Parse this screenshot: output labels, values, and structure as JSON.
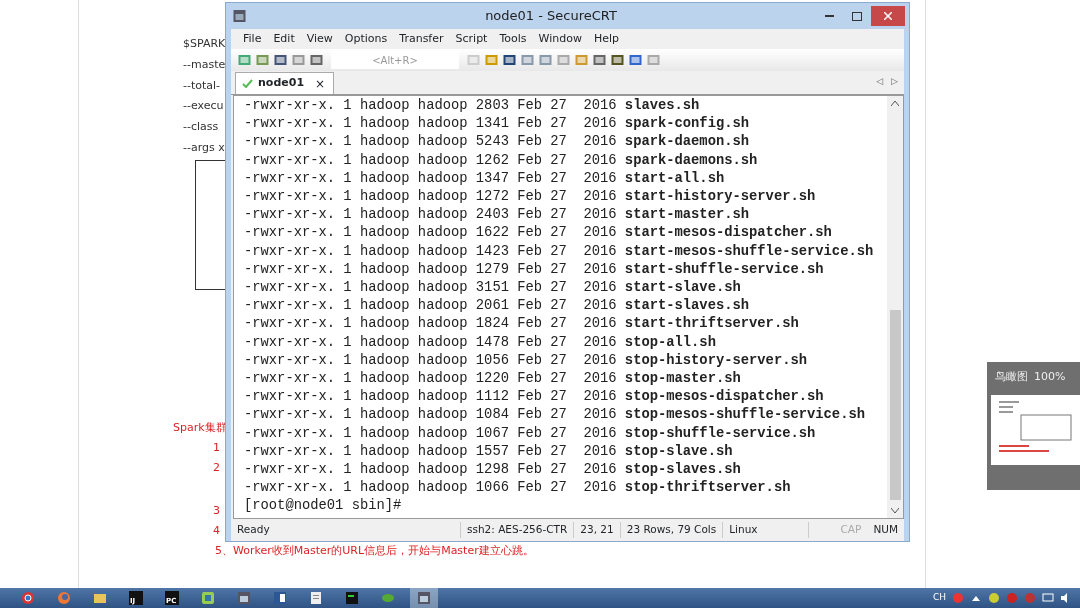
{
  "document": {
    "lines": [
      "$SPARK",
      "--maste",
      "--total-",
      "--execu",
      "--class",
      "--args x"
    ],
    "notes": [
      "Spark集群",
      "1",
      "2",
      "3",
      "4",
      "5、Worker收到Master的URL信息后，开始与Master建立心跳。"
    ]
  },
  "window": {
    "title": "node01 - SecureCRT",
    "menu": [
      "File",
      "Edit",
      "View",
      "Options",
      "Transfer",
      "Script",
      "Tools",
      "Window",
      "Help"
    ],
    "toolbar": {
      "placeholder": "<Alt+R>"
    },
    "tabs": [
      {
        "label": "node01",
        "close": "×",
        "selected": true,
        "connected": true
      }
    ],
    "tab_scroll": [
      "◁",
      "▷"
    ],
    "terminal": {
      "lines": [
        {
          "meta": "-rwxr-xr-x. 1 hadoop hadoop 2803 Feb 27  2016",
          "file": "slaves.sh"
        },
        {
          "meta": "-rwxr-xr-x. 1 hadoop hadoop 1341 Feb 27  2016",
          "file": "spark-config.sh"
        },
        {
          "meta": "-rwxr-xr-x. 1 hadoop hadoop 5243 Feb 27  2016",
          "file": "spark-daemon.sh"
        },
        {
          "meta": "-rwxr-xr-x. 1 hadoop hadoop 1262 Feb 27  2016",
          "file": "spark-daemons.sh"
        },
        {
          "meta": "-rwxr-xr-x. 1 hadoop hadoop 1347 Feb 27  2016",
          "file": "start-all.sh"
        },
        {
          "meta": "-rwxr-xr-x. 1 hadoop hadoop 1272 Feb 27  2016",
          "file": "start-history-server.sh"
        },
        {
          "meta": "-rwxr-xr-x. 1 hadoop hadoop 2403 Feb 27  2016",
          "file": "start-master.sh"
        },
        {
          "meta": "-rwxr-xr-x. 1 hadoop hadoop 1622 Feb 27  2016",
          "file": "start-mesos-dispatcher.sh"
        },
        {
          "meta": "-rwxr-xr-x. 1 hadoop hadoop 1423 Feb 27  2016",
          "file": "start-mesos-shuffle-service.sh"
        },
        {
          "meta": "-rwxr-xr-x. 1 hadoop hadoop 1279 Feb 27  2016",
          "file": "start-shuffle-service.sh"
        },
        {
          "meta": "-rwxr-xr-x. 1 hadoop hadoop 3151 Feb 27  2016",
          "file": "start-slave.sh"
        },
        {
          "meta": "-rwxr-xr-x. 1 hadoop hadoop 2061 Feb 27  2016",
          "file": "start-slaves.sh"
        },
        {
          "meta": "-rwxr-xr-x. 1 hadoop hadoop 1824 Feb 27  2016",
          "file": "start-thriftserver.sh"
        },
        {
          "meta": "-rwxr-xr-x. 1 hadoop hadoop 1478 Feb 27  2016",
          "file": "stop-all.sh"
        },
        {
          "meta": "-rwxr-xr-x. 1 hadoop hadoop 1056 Feb 27  2016",
          "file": "stop-history-server.sh"
        },
        {
          "meta": "-rwxr-xr-x. 1 hadoop hadoop 1220 Feb 27  2016",
          "file": "stop-master.sh"
        },
        {
          "meta": "-rwxr-xr-x. 1 hadoop hadoop 1112 Feb 27  2016",
          "file": "stop-mesos-dispatcher.sh"
        },
        {
          "meta": "-rwxr-xr-x. 1 hadoop hadoop 1084 Feb 27  2016",
          "file": "stop-mesos-shuffle-service.sh"
        },
        {
          "meta": "-rwxr-xr-x. 1 hadoop hadoop 1067 Feb 27  2016",
          "file": "stop-shuffle-service.sh"
        },
        {
          "meta": "-rwxr-xr-x. 1 hadoop hadoop 1557 Feb 27  2016",
          "file": "stop-slave.sh"
        },
        {
          "meta": "-rwxr-xr-x. 1 hadoop hadoop 1298 Feb 27  2016",
          "file": "stop-slaves.sh"
        },
        {
          "meta": "-rwxr-xr-x. 1 hadoop hadoop 1066 Feb 27  2016",
          "file": "stop-thriftserver.sh"
        }
      ],
      "prompt": "[root@node01 sbin]#"
    },
    "status_bar": {
      "fields": [
        "Ready",
        "ssh2: AES-256-CTR",
        "23,  21",
        "23 Rows, 79 Cols",
        "Linux"
      ],
      "keys": [
        {
          "label": "CAP",
          "on": false
        },
        {
          "label": "NUM",
          "on": true
        }
      ]
    }
  },
  "overview": {
    "title": "鸟瞰图",
    "zoom": "100%"
  },
  "taskbar": {
    "apps": [
      {
        "kind": "chrome",
        "selected": false
      },
      {
        "kind": "firefox",
        "selected": false
      },
      {
        "kind": "folder",
        "selected": false
      },
      {
        "kind": "letters",
        "label": "IJ",
        "selected": false
      },
      {
        "kind": "letters",
        "label": "PC",
        "selected": false
      },
      {
        "kind": "square",
        "selected": false
      },
      {
        "kind": "crt",
        "selected": false
      },
      {
        "kind": "word",
        "selected": false
      },
      {
        "kind": "notepad",
        "selected": false
      },
      {
        "kind": "console",
        "selected": false
      },
      {
        "kind": "leaf",
        "selected": false
      },
      {
        "kind": "crt",
        "selected": true
      }
    ],
    "input": "CH"
  }
}
